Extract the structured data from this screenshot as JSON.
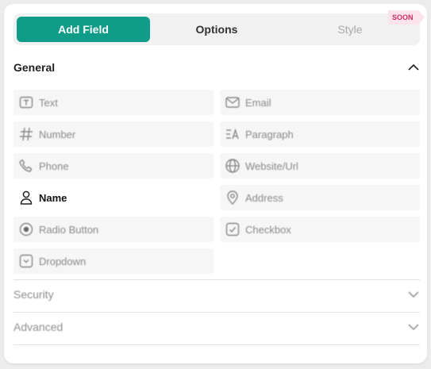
{
  "tabs": {
    "add_field": "Add Field",
    "options": "Options",
    "style": "Style",
    "soon_badge": "SOON"
  },
  "sections": {
    "general": "General",
    "security": "Security",
    "advanced": "Advanced"
  },
  "fields": [
    {
      "label": "Text",
      "icon": "text-field-icon"
    },
    {
      "label": "Email",
      "icon": "envelope-icon"
    },
    {
      "label": "Number",
      "icon": "hash-icon"
    },
    {
      "label": "Paragraph",
      "icon": "paragraph-icon"
    },
    {
      "label": "Phone",
      "icon": "phone-icon"
    },
    {
      "label": "Website/Url",
      "icon": "globe-icon"
    },
    {
      "label": "Name",
      "icon": "person-icon"
    },
    {
      "label": "Address",
      "icon": "map-pin-icon"
    },
    {
      "label": "Radio Button",
      "icon": "radio-icon"
    },
    {
      "label": "Checkbox",
      "icon": "checkbox-icon"
    },
    {
      "label": "Dropdown",
      "icon": "dropdown-icon"
    }
  ],
  "colors": {
    "accent": "#0f9d8a",
    "soon_bg": "#fde4ec",
    "soon_text": "#d02b63"
  }
}
